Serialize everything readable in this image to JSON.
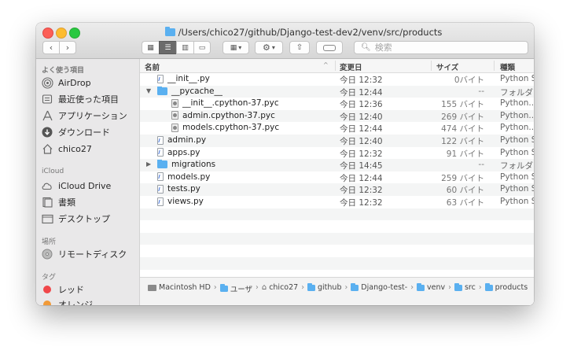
{
  "window": {
    "title": "/Users/chico27/github/Django-test-dev2/venv/src/products"
  },
  "toolbar": {
    "back": "‹",
    "forward": "›",
    "view_modes": [
      "icon",
      "list",
      "column",
      "gallery"
    ],
    "group_label": "▾",
    "action_label": "▾",
    "search_placeholder": "検索"
  },
  "sidebar": {
    "favorites_header": "よく使う項目",
    "favorites": [
      {
        "label": "AirDrop",
        "icon": "airdrop-icon"
      },
      {
        "label": "最近使った項目",
        "icon": "recents-icon"
      },
      {
        "label": "アプリケーション",
        "icon": "applications-icon"
      },
      {
        "label": "ダウンロード",
        "icon": "downloads-icon"
      },
      {
        "label": "chico27",
        "icon": "home-icon"
      }
    ],
    "icloud_header": "iCloud",
    "icloud": [
      {
        "label": "iCloud Drive",
        "icon": "cloud-icon"
      },
      {
        "label": "書類",
        "icon": "documents-icon"
      },
      {
        "label": "デスクトップ",
        "icon": "desktop-icon"
      }
    ],
    "locations_header": "場所",
    "locations": [
      {
        "label": "リモートディスク",
        "icon": "disc-icon"
      }
    ],
    "tags_header": "タグ",
    "tags": [
      {
        "label": "レッド",
        "color": "#f0474a"
      },
      {
        "label": "オレンジ",
        "color": "#f19a38"
      }
    ]
  },
  "columns": {
    "name": "名前",
    "date": "変更日",
    "size": "サイズ",
    "kind": "種類"
  },
  "files": [
    {
      "name": "__init__.py",
      "date": "今日 12:32",
      "size": "0バイト",
      "kind": "Python So",
      "indent": 1,
      "type": "py",
      "disclosure": ""
    },
    {
      "name": "__pycache__",
      "date": "今日 12:44",
      "size": "--",
      "kind": "フォルダ",
      "indent": 0,
      "type": "folder",
      "disclosure": "▼"
    },
    {
      "name": "__init__.cpython-37.pyc",
      "date": "今日 12:36",
      "size": "155 バイト",
      "kind": "Python...c",
      "indent": 2,
      "type": "pyc",
      "disclosure": ""
    },
    {
      "name": "admin.cpython-37.pyc",
      "date": "今日 12:40",
      "size": "269 バイト",
      "kind": "Python...c",
      "indent": 2,
      "type": "pyc",
      "disclosure": ""
    },
    {
      "name": "models.cpython-37.pyc",
      "date": "今日 12:44",
      "size": "474 バイト",
      "kind": "Python...c",
      "indent": 2,
      "type": "pyc",
      "disclosure": ""
    },
    {
      "name": "admin.py",
      "date": "今日 12:40",
      "size": "122 バイト",
      "kind": "Python So",
      "indent": 1,
      "type": "py",
      "disclosure": ""
    },
    {
      "name": "apps.py",
      "date": "今日 12:32",
      "size": "91 バイト",
      "kind": "Python So",
      "indent": 1,
      "type": "py",
      "disclosure": ""
    },
    {
      "name": "migrations",
      "date": "今日 14:45",
      "size": "--",
      "kind": "フォルダ",
      "indent": 0,
      "type": "folder",
      "disclosure": "▶"
    },
    {
      "name": "models.py",
      "date": "今日 12:44",
      "size": "259 バイト",
      "kind": "Python So",
      "indent": 1,
      "type": "py",
      "disclosure": ""
    },
    {
      "name": "tests.py",
      "date": "今日 12:32",
      "size": "60 バイト",
      "kind": "Python So",
      "indent": 1,
      "type": "py",
      "disclosure": ""
    },
    {
      "name": "views.py",
      "date": "今日 12:32",
      "size": "63 バイト",
      "kind": "Python So",
      "indent": 1,
      "type": "py",
      "disclosure": ""
    }
  ],
  "pathbar": [
    {
      "label": "Macintosh HD",
      "icon": "disk-icon"
    },
    {
      "label": "ユーザ",
      "icon": "folder-icon"
    },
    {
      "label": "chico27",
      "icon": "home-icon"
    },
    {
      "label": "github",
      "icon": "folder-icon"
    },
    {
      "label": "Django-test-",
      "icon": "folder-icon"
    },
    {
      "label": "venv",
      "icon": "folder-icon"
    },
    {
      "label": "src",
      "icon": "folder-icon"
    },
    {
      "label": "products",
      "icon": "folder-icon"
    }
  ],
  "colors": {
    "folder": "#5ab0f0",
    "tag_red": "#f0474a",
    "tag_orange": "#f19a38"
  }
}
